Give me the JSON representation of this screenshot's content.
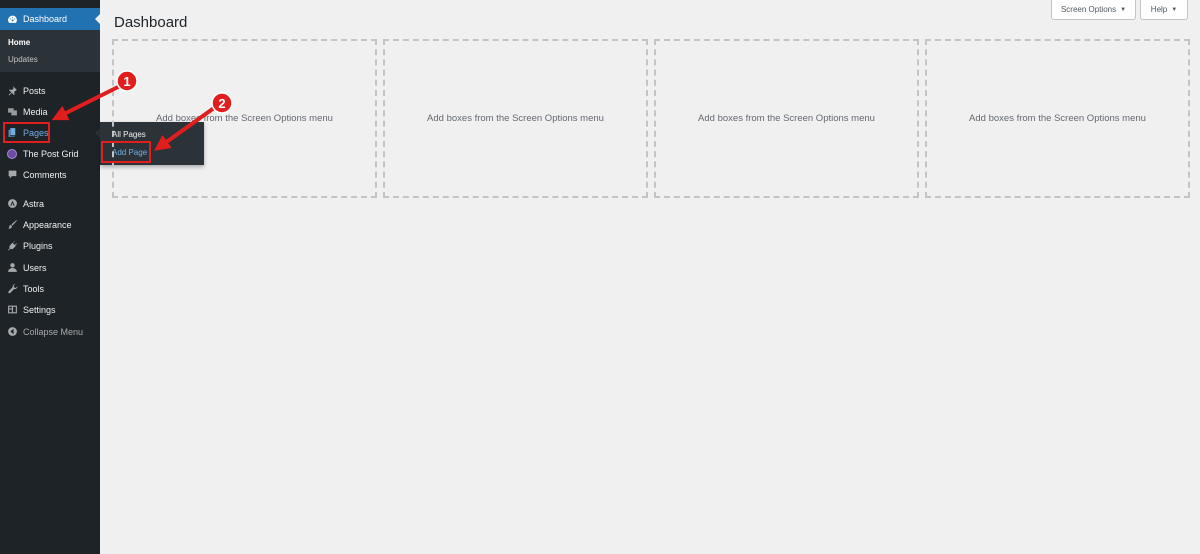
{
  "sidebar": {
    "dashboard_label": "Dashboard",
    "dashboard_submenu": {
      "home": "Home",
      "updates": "Updates"
    },
    "items": [
      {
        "label": "Posts",
        "icon": "pin-icon"
      },
      {
        "label": "Media",
        "icon": "media-icon"
      },
      {
        "label": "Pages",
        "icon": "pages-icon"
      },
      {
        "label": "The Post Grid",
        "icon": "post-grid-icon"
      },
      {
        "label": "Comments",
        "icon": "comments-icon"
      },
      {
        "label": "Astra",
        "icon": "astra-icon"
      },
      {
        "label": "Appearance",
        "icon": "brush-icon"
      },
      {
        "label": "Plugins",
        "icon": "plugin-icon"
      },
      {
        "label": "Users",
        "icon": "users-icon"
      },
      {
        "label": "Tools",
        "icon": "wrench-icon"
      },
      {
        "label": "Settings",
        "icon": "settings-icon"
      },
      {
        "label": "Collapse Menu",
        "icon": "collapse-icon"
      }
    ]
  },
  "flyout": {
    "all_pages": "All Pages",
    "add_page": "Add Page"
  },
  "header": {
    "title": "Dashboard",
    "screen_options": "Screen Options",
    "help": "Help"
  },
  "boxes": {
    "placeholder_1": "Add boxes from the Screen Options menu",
    "placeholder_2": "Add boxes from the Screen Options menu",
    "placeholder_3": "Add boxes from the Screen Options menu",
    "placeholder_4": "Add boxes from the Screen Options menu"
  },
  "annotations": {
    "step1": "1",
    "step2": "2"
  },
  "colors": {
    "sidebar_bg": "#1d2327",
    "accent": "#2271b1",
    "link_active": "#72aee6",
    "annotation_red": "#e01e1e"
  }
}
